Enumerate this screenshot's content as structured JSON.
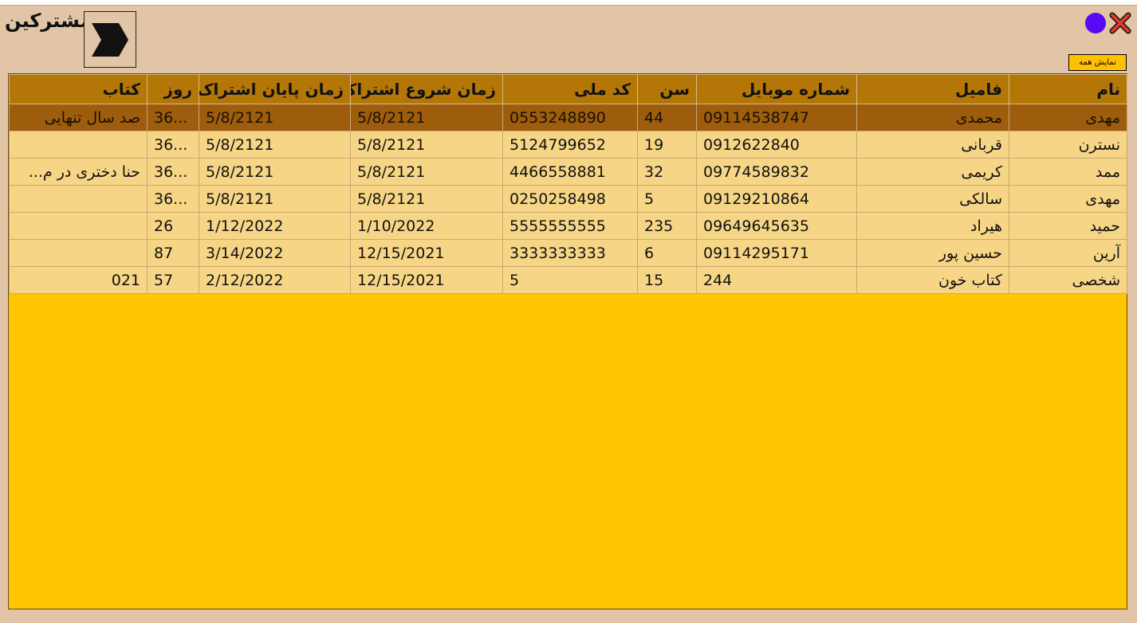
{
  "window": {
    "title": "مشترکین",
    "show_all_label": "نمایش همه",
    "close_color": "#e03a2a",
    "dot_color": "#5a0af2"
  },
  "table": {
    "headers": [
      "نام",
      "فامیل",
      "شماره موبایل",
      "سن",
      "کد ملی",
      "زمان شروع اشتراک",
      "زمان پایان اشتراک",
      "روز",
      "کتاب"
    ],
    "rows": [
      [
        "مهدی",
        "محمدی",
        "09114538747",
        "44",
        "0553248890",
        "5/8/2121",
        "5/8/2121",
        "36...",
        "صد سال تنهایی"
      ],
      [
        "نسترن",
        "قربانی",
        "0912622840",
        "19",
        "5124799652",
        "5/8/2121",
        "5/8/2121",
        "36...",
        ""
      ],
      [
        "ممد",
        "کریمی",
        "09774589832",
        "32",
        "4466558881",
        "5/8/2121",
        "5/8/2121",
        "36...",
        "حنا دختری در م..."
      ],
      [
        "مهدی",
        "سالکی",
        "09129210864",
        "5",
        "0250258498",
        "5/8/2121",
        "5/8/2121",
        "36...",
        ""
      ],
      [
        "حمید",
        "هیراد",
        "09649645635",
        "235",
        "5555555555",
        "1/10/2022",
        "1/12/2022",
        "26",
        ""
      ],
      [
        "آرین",
        "حسین پور",
        "09114295171",
        "6",
        "3333333333",
        "12/15/2021",
        "3/14/2022",
        "87",
        ""
      ],
      [
        "شخصی",
        "کتاب خون",
        "244",
        "15",
        "5",
        "12/15/2021",
        "2/12/2022",
        "57",
        "021"
      ]
    ],
    "selected_row": 0,
    "colors": {
      "header": "#b47707",
      "row": "#f6d686",
      "selected": "#9d5d0d",
      "empty": "#ffc500"
    }
  }
}
